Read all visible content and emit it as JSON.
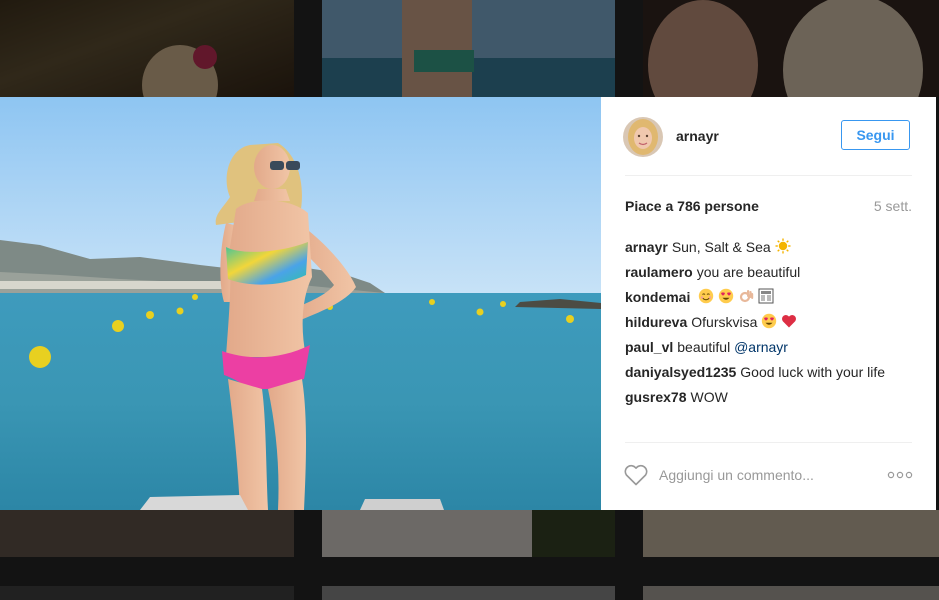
{
  "post": {
    "username": "arnayr",
    "follow_label": "Segui",
    "likes_text": "Piace a 786 persone",
    "time_ago": "5 sett.",
    "add_comment_placeholder": "Aggiungi un commento...",
    "more_label": "ooo"
  },
  "comments": [
    {
      "user": "arnayr",
      "text": "Sun, Salt & Sea",
      "emojis": [
        "sun-emoji"
      ]
    },
    {
      "user": "raulamero",
      "text": "you are beautiful",
      "emojis": []
    },
    {
      "user": "kondemai",
      "text": "",
      "emojis": [
        "smiling-face-emoji",
        "heart-eyes-emoji",
        "ok-hand-emoji",
        "flag-emoji"
      ]
    },
    {
      "user": "hildureva",
      "text": "Ofurskvisa",
      "emojis": [
        "heart-eyes-emoji",
        "red-heart-emoji"
      ]
    },
    {
      "user": "paul_vl",
      "text": "beautiful",
      "mention": "@arnayr",
      "emojis": []
    },
    {
      "user": "daniyalsyed1235",
      "text": "Good luck with your life",
      "emojis": []
    },
    {
      "user": "gusrex78",
      "text": "WOW",
      "emojis": []
    }
  ],
  "colors": {
    "accent": "#3897f0",
    "text": "#262626",
    "muted": "#999999",
    "mention": "#003569"
  }
}
